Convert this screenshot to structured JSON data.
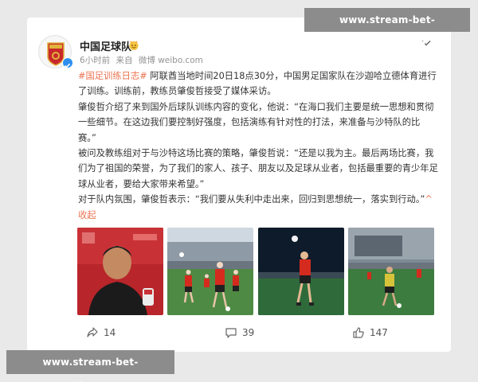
{
  "watermark": {
    "top_text": "www.stream-bet-worldcup.com",
    "bottom_text": "www.stream-bet-worldcup.com"
  },
  "post": {
    "author": "中国足球队",
    "meta": {
      "time": "6小时前",
      "source_prefix": "来自",
      "source": "微博 weibo.com"
    },
    "paragraphs": {
      "p1_topic": "#国足训练日志#",
      "p1_text": " 阿联酋当地时间20日18点30分，中国男足国家队在沙迦哈立德体育进行了训练。训练前，教练员肇俊哲接受了媒体采访。",
      "p2_text": "肇俊哲介绍了来到国外后球队训练内容的变化，他说：“在海口我们主要是统一思想和贯彻一些细节。在这边我们要控制好强度，包括演练有针对性的打法，来准备与沙特队的比赛。”",
      "p3_text": "被问及教练组对于与沙特这场比赛的策略，肇俊哲说：“还是以我为主。最后两场比赛，我们为了祖国的荣誉，为了我们的家人、孩子、朋友以及足球从业者，包括最重要的青少年足球从业者，要给大家带来希望。”",
      "p4_text": "对于队内氛围，肇俊哲表示：“我们要从失利中走出来，回归到思想统一，落实到行动。”",
      "collapse_label": "收起"
    },
    "actions": {
      "share_count": "14",
      "comment_count": "39",
      "like_count": "147"
    }
  },
  "colors": {
    "link": "#eb7350",
    "verified": "#2e8fee",
    "jersey_red": "#d42b1e"
  },
  "icons": [
    "more-chevron-icon",
    "share-icon",
    "comment-icon",
    "like-icon",
    "verified-icon",
    "fan-badge-icon"
  ]
}
